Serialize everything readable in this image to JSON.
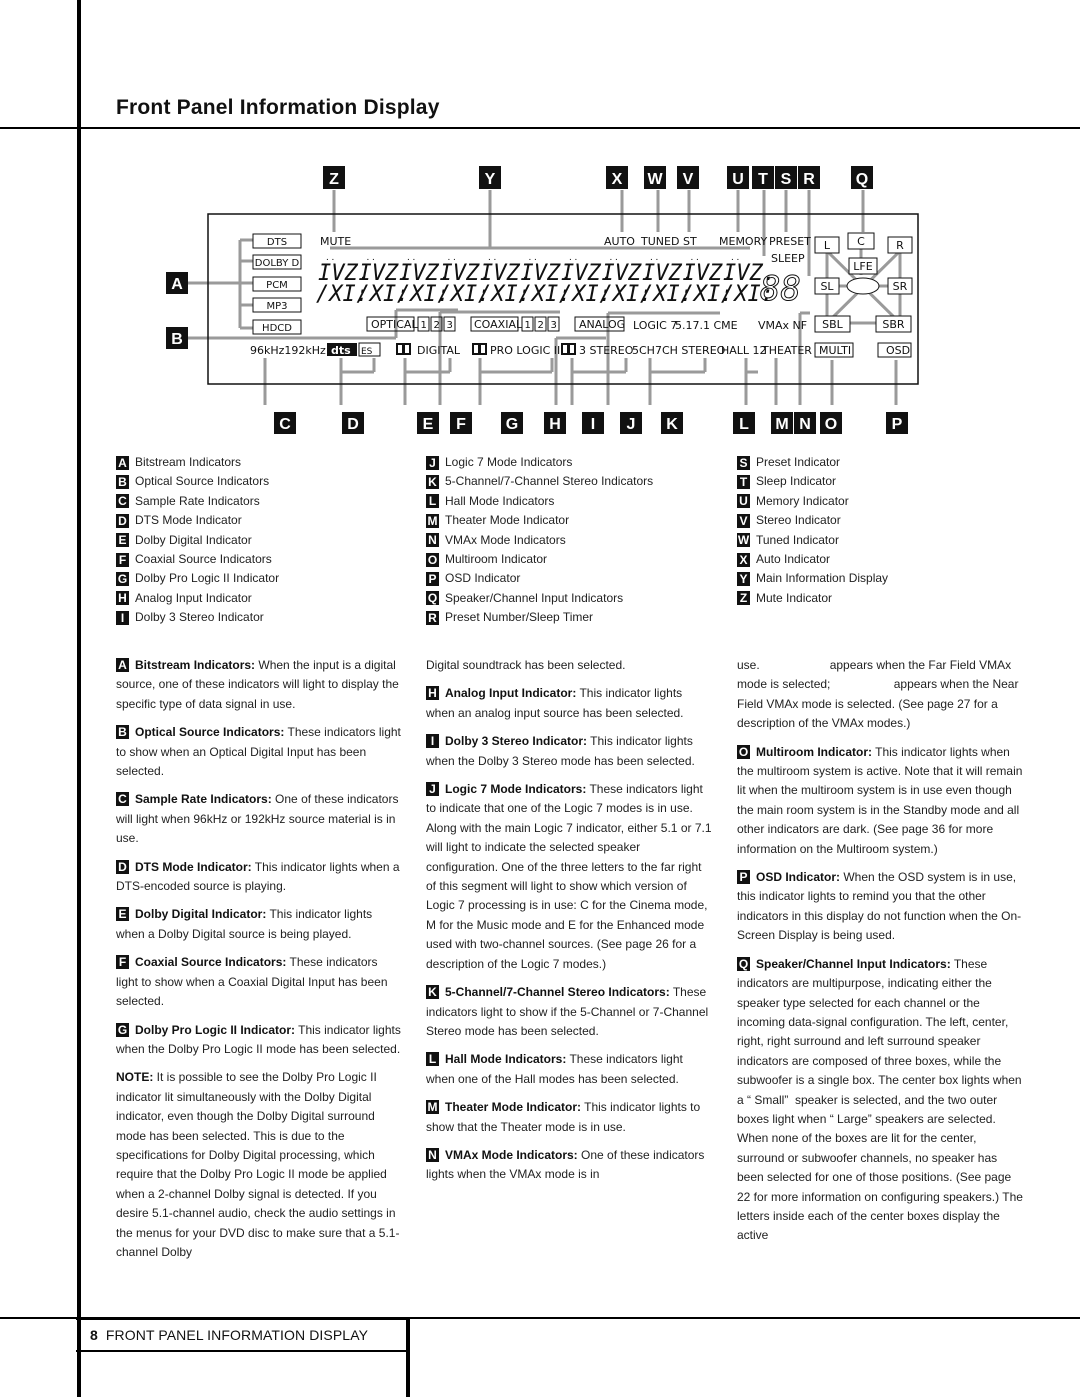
{
  "page": {
    "title": "Front Panel Information Display",
    "footer_number": "8",
    "footer_title": "FRONT PANEL INFORMATION DISPLAY"
  },
  "display": {
    "bitstream_labels": [
      "DTS",
      "DOLBY D",
      "PCM",
      "MP3",
      "HDCD"
    ],
    "mute": "MUTE",
    "top_indicators": [
      "AUTO",
      "TUNED",
      "ST",
      "MEMORY",
      "PRESET"
    ],
    "sleep": "SLEEP",
    "preset_digits": "88",
    "optical": "OPTICAL",
    "coaxial": "COAXIAL",
    "input_numbers": [
      "1",
      "2",
      "3"
    ],
    "analog": "ANALOG",
    "logic7": "LOGIC 7",
    "logic7_options": "5.17.1 CME",
    "vmax": "VMAx NF",
    "sample_rates": "96kHz192kHz",
    "dts_logo": "dts",
    "es_logo": "ES",
    "dolby_symbol": "DD",
    "digital": "DIGITAL",
    "pro_logic": "PRO LOGIC II",
    "three_stereo": "3 STEREO",
    "ch_stereo": "5CH7CH STEREO",
    "hall": "HALL 12",
    "theater": "THEATER",
    "speakers": [
      "L",
      "C",
      "R",
      "LFE",
      "SL",
      "SR",
      "SBL",
      "SBR"
    ],
    "multi": "MULTI",
    "osd": "OSD"
  },
  "callouts_top": [
    "Z",
    "Y",
    "X",
    "W",
    "V",
    "U",
    "T",
    "S",
    "R",
    "Q"
  ],
  "callouts_bottom": [
    "C",
    "D",
    "E",
    "F",
    "G",
    "H",
    "I",
    "J",
    "K",
    "L",
    "M",
    "N",
    "O",
    "P"
  ],
  "callouts_left": [
    "A",
    "B"
  ],
  "legend": {
    "col1": [
      {
        "key": "A",
        "label": "Bitstream Indicators"
      },
      {
        "key": "B",
        "label": "Optical Source Indicators"
      },
      {
        "key": "C",
        "label": "Sample Rate Indicators"
      },
      {
        "key": "D",
        "label": "DTS Mode Indicator"
      },
      {
        "key": "E",
        "label": "Dolby Digital Indicator"
      },
      {
        "key": "F",
        "label": "Coaxial Source Indicators"
      },
      {
        "key": "G",
        "label": "Dolby Pro Logic II Indicator"
      },
      {
        "key": "H",
        "label": "Analog Input Indicator"
      },
      {
        "key": "I",
        "label": "Dolby 3 Stereo Indicator"
      }
    ],
    "col2": [
      {
        "key": "J",
        "label": "Logic 7 Mode Indicators"
      },
      {
        "key": "K",
        "label": "5-Channel/7-Channel Stereo Indicators"
      },
      {
        "key": "L",
        "label": "Hall Mode Indicators"
      },
      {
        "key": "M",
        "label": "Theater Mode Indicator"
      },
      {
        "key": "N",
        "label": "VMAx Mode Indicators"
      },
      {
        "key": "O",
        "label": "Multiroom Indicator"
      },
      {
        "key": "P",
        "label": "OSD Indicator"
      },
      {
        "key": "Q",
        "label": "Speaker/Channel Input Indicators"
      },
      {
        "key": "R",
        "label": "Preset Number/Sleep Timer"
      }
    ],
    "col3": [
      {
        "key": "S",
        "label": "Preset Indicator"
      },
      {
        "key": "T",
        "label": "Sleep Indicator"
      },
      {
        "key": "U",
        "label": "Memory Indicator"
      },
      {
        "key": "V",
        "label": "Stereo Indicator"
      },
      {
        "key": "W",
        "label": "Tuned Indicator"
      },
      {
        "key": "X",
        "label": "Auto Indicator"
      },
      {
        "key": "Y",
        "label": "Main Information Display"
      },
      {
        "key": "Z",
        "label": "Mute Indicator"
      }
    ]
  },
  "body": {
    "col1": [
      {
        "key": "A",
        "heading": "Bitstream Indicators:",
        "text": " When the input is a digital source, one of these indicators will light to display the specific type of data signal in use."
      },
      {
        "key": "B",
        "heading": "Optical Source Indicators:",
        "text": " These indicators light to show when an Optical Digital Input has been selected."
      },
      {
        "key": "C",
        "heading": "Sample Rate Indicators:",
        "text": " One of these indicators will light when 96kHz or 192kHz source material is in use."
      },
      {
        "key": "D",
        "heading": "DTS Mode Indicator:",
        "text": " This indicator lights when a DTS-encoded source is playing."
      },
      {
        "key": "E",
        "heading": "Dolby Digital Indicator:",
        "text": " This indicator lights when a Dolby Digital source is being played."
      },
      {
        "key": "F",
        "heading": "Coaxial Source Indicators:",
        "text": " These indicators light to show when a Coaxial Digital Input has been selected."
      },
      {
        "key": "G",
        "heading": "Dolby Pro Logic II Indicator:",
        "text": " This indicator lights when the Dolby Pro Logic II mode has been selected."
      },
      {
        "key": "",
        "heading": "NOTE:",
        "text": " It is possible to see the Dolby Pro Logic II indicator lit simultaneously with the Dolby Digital indicator, even though the Dolby Digital surround mode has been selected. This is due to the specifications for Dolby Digital processing, which require that the Dolby Pro Logic II mode be applied when a 2-channel Dolby signal is detected. If you desire 5.1-channel audio, check the audio settings in the menus for your DVD disc to make sure that a 5.1-channel Dolby"
      }
    ],
    "col2": [
      {
        "key": "",
        "heading": "",
        "text": "Digital soundtrack has been selected."
      },
      {
        "key": "H",
        "heading": "Analog Input Indicator:",
        "text": " This indicator lights when an analog input source has been selected."
      },
      {
        "key": "I",
        "heading": "Dolby 3 Stereo Indicator:",
        "text": " This indicator lights when the Dolby 3 Stereo mode has been selected."
      },
      {
        "key": "J",
        "heading": "Logic 7 Mode Indicators:",
        "text": " These indicators light to indicate that one of the Logic 7 modes is in use. Along with the main Logic 7 indicator, either 5.1 or 7.1 will light to indicate the selected speaker configuration. One of the three letters to the far right of this segment will light to show which version of Logic 7 processing is in use: C for the Cinema mode, M for the Music mode and E for the Enhanced mode used with two-channel sources. (See page 26 for a description of the Logic 7 modes.)"
      },
      {
        "key": "K",
        "heading": "5-Channel/7-Channel Stereo Indicators:",
        "text": " These indicators light to show if the 5-Channel or 7-Channel Stereo mode has been selected."
      },
      {
        "key": "L",
        "heading": "Hall Mode Indicators:",
        "text": " These indicators light when one of the Hall modes has been selected."
      },
      {
        "key": "M",
        "heading": "Theater Mode Indicator:",
        "text": " This indicator lights to show that the Theater mode is in use."
      },
      {
        "key": "N",
        "heading": "VMAx Mode Indicators:",
        "text": " One of these indicators lights when the VMAx mode is in"
      }
    ],
    "col3": [
      {
        "key": "",
        "heading": "",
        "text": "use.                     appears when the Far Field VMAx mode is selected;                   appears when the Near Field VMAx mode is selected. (See page 27 for a description of the VMAx modes.)"
      },
      {
        "key": "O",
        "heading": "Multiroom Indicator:",
        "text": " This indicator lights when the multiroom system is active. Note that it will remain lit when the multiroom system is in use even though the main room system is in the Standby mode and all other indicators are dark. (See page 36 for more information on the Multiroom system.)"
      },
      {
        "key": "P",
        "heading": "OSD Indicator:",
        "text": " When the OSD system is in use, this indicator lights to remind you that the other indicators in this display do not function when the On-Screen Display is being used."
      },
      {
        "key": "Q",
        "heading": "Speaker/Channel Input Indicators:",
        "text": " These indicators are multipurpose, indicating either the speaker type selected for each channel or the incoming data-signal configuration. The left, center, right, right surround and left surround speaker indicators are composed of three boxes, while the subwoofer is a single box. The center box lights when a “ Small”  speaker is selected, and the two outer boxes light when “ Large” speakers are selected. When none of the boxes are lit for the center, surround or subwoofer channels, no speaker has been selected for one of those positions. (See page 22 for more information on configuring speakers.) The letters inside each of the center boxes display the active"
      }
    ]
  },
  "colors": {
    "ink": "#111111",
    "leader": "#9a9a9a",
    "badge_text": "#ffffff"
  }
}
